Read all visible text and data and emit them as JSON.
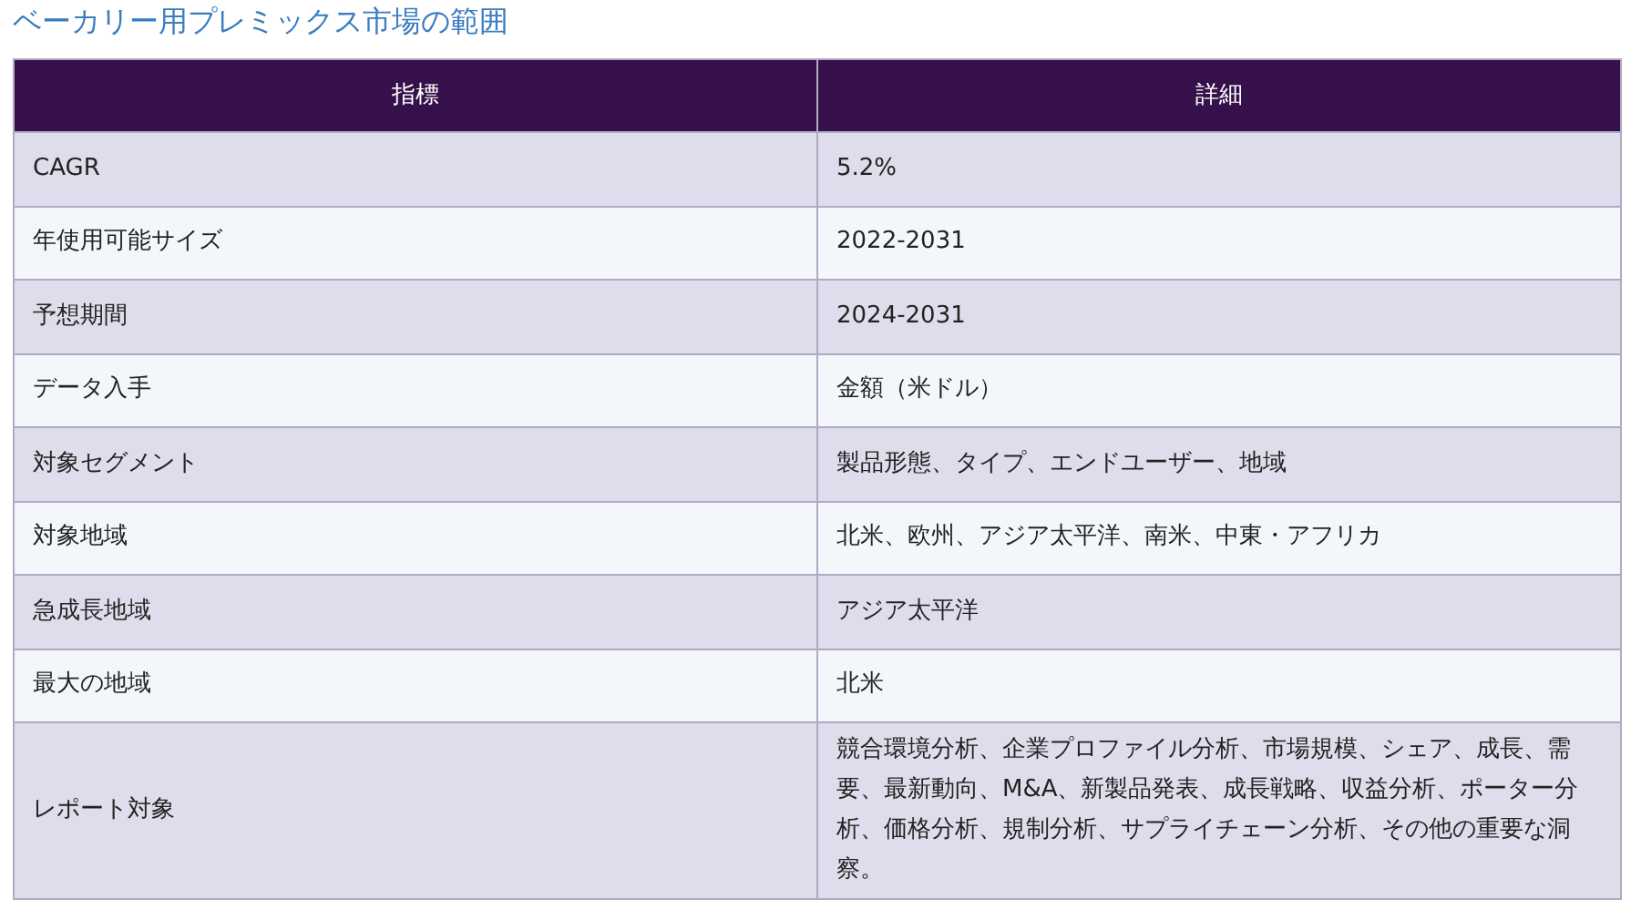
{
  "title": "ベーカリー用プレミックス市場の範囲",
  "table": {
    "columns": [
      "指標",
      "詳細"
    ],
    "rows": [
      [
        "CAGR",
        "5.2%"
      ],
      [
        "年使用可能サイズ",
        "2022-2031"
      ],
      [
        "予想期間",
        "2024-2031"
      ],
      [
        "データ入手",
        "金額（米ドル）"
      ],
      [
        "対象セグメント",
        "製品形態、タイプ、エンドユーザー、地域"
      ],
      [
        "対象地域",
        "北米、欧州、アジア太平洋、南米、中東・アフリカ"
      ],
      [
        "急成長地域",
        "アジア太平洋"
      ],
      [
        "最大の地域",
        "北米"
      ],
      [
        "レポート対象",
        "競合環境分析、企業プロファイル分析、市場規模、シェア、成長、需要、最新動向、M&A、新製品発表、成長戦略、収益分析、ポーター分析、価格分析、規制分析、サプライチェーン分析、その他の重要な洞察。"
      ]
    ]
  }
}
